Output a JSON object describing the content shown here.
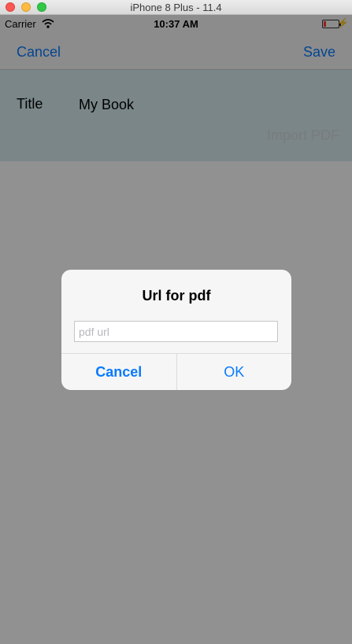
{
  "window": {
    "title": "iPhone 8 Plus - 11.4"
  },
  "status_bar": {
    "carrier": "Carrier",
    "time": "10:37 AM"
  },
  "nav": {
    "cancel_label": "Cancel",
    "save_label": "Save"
  },
  "form": {
    "title_label": "Title",
    "title_value": "My Book",
    "import_label": "Import PDF"
  },
  "alert": {
    "title": "Url for pdf",
    "input_placeholder": "pdf url",
    "input_value": "",
    "cancel_label": "Cancel",
    "ok_label": "OK"
  },
  "colors": {
    "accent": "#0a7aff",
    "form_background": "#d7ecef",
    "battery_low": "#ff3b30"
  },
  "icons": [
    "wifi-icon",
    "battery-icon",
    "charging-icon"
  ]
}
